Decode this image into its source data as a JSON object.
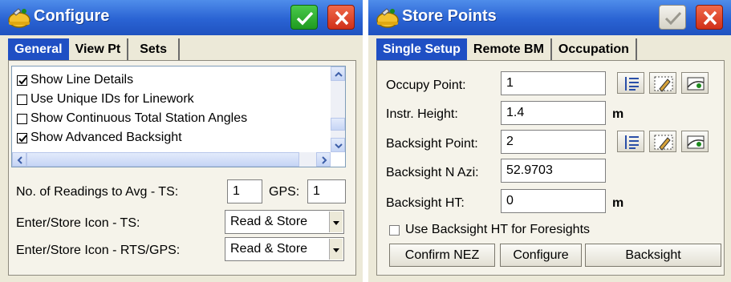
{
  "configure": {
    "title": "Configure",
    "tabs": [
      "General",
      "View Pt",
      "Sets"
    ],
    "options": [
      {
        "label": "Show Line Details",
        "checked": true
      },
      {
        "label": "Use Unique IDs for Linework",
        "checked": false
      },
      {
        "label": "Show Continuous Total Station Angles",
        "checked": false
      },
      {
        "label": "Show Advanced Backsight",
        "checked": true
      }
    ],
    "readings_label": "No. of Readings to Avg  -  TS:",
    "readings_ts": "1",
    "gps_label": "GPS:",
    "readings_gps": "1",
    "store_ts_label": "Enter/Store Icon - TS:",
    "store_ts_value": "Read & Store",
    "store_rts_label": "Enter/Store Icon - RTS/GPS:",
    "store_rts_value": "Read & Store"
  },
  "store": {
    "title": "Store Points",
    "tabs": [
      "Single Setup",
      "Remote BM",
      "Occupation"
    ],
    "occupy_label": "Occupy Point:",
    "occupy_value": "1",
    "instr_label": "Instr. Height:",
    "instr_value": "1.4",
    "instr_unit": "m",
    "backsight_label": "Backsight Point:",
    "backsight_value": "2",
    "azi_label": "Backsight N Azi:",
    "azi_value": "52.9703",
    "bsht_label": "Backsight HT:",
    "bsht_value": "0",
    "bsht_unit": "m",
    "use_bsht_label": "Use Backsight HT for Foresights",
    "use_bsht_checked": false,
    "buttons": [
      "Confirm NEZ",
      "Configure",
      "Backsight"
    ]
  },
  "icons": {
    "app": "satellite-helmet-icon",
    "ok": "checkmark-icon",
    "close": "x-close-icon",
    "list": "point-list-icon",
    "edit": "edit-pencil-icon",
    "map": "map-pick-icon"
  },
  "colors": {
    "title_bar": "#2a63d3",
    "tab_active": "#1f4fc4",
    "ok_green": "#1f9a20",
    "close_red": "#d0301a",
    "dialog_bg": "#ece9d8"
  }
}
